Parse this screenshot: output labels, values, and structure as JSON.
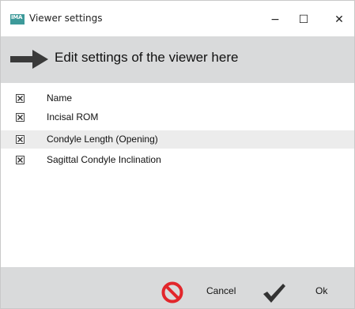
{
  "window": {
    "app_icon_text": "IMA",
    "title": "Viewer settings",
    "minimize": "−",
    "maximize": "☐",
    "close": "✕"
  },
  "header": {
    "icon": "arrow-right-icon",
    "text": "Edit settings of the viewer here"
  },
  "table": {
    "columns": [
      "Name"
    ],
    "header_checked": true,
    "rows": [
      {
        "name": "Incisal ROM",
        "checked": true,
        "selected": false
      },
      {
        "name": "Condyle Length (Opening)",
        "checked": true,
        "selected": true
      },
      {
        "name": "Sagittal Condyle Inclination",
        "checked": true,
        "selected": false
      }
    ]
  },
  "footer": {
    "cancel_label": "Cancel",
    "ok_label": "Ok",
    "cancel_icon": "no-entry-icon",
    "ok_icon": "checkmark-icon",
    "cancel_color": "#e2262b",
    "ok_color": "#333333"
  }
}
